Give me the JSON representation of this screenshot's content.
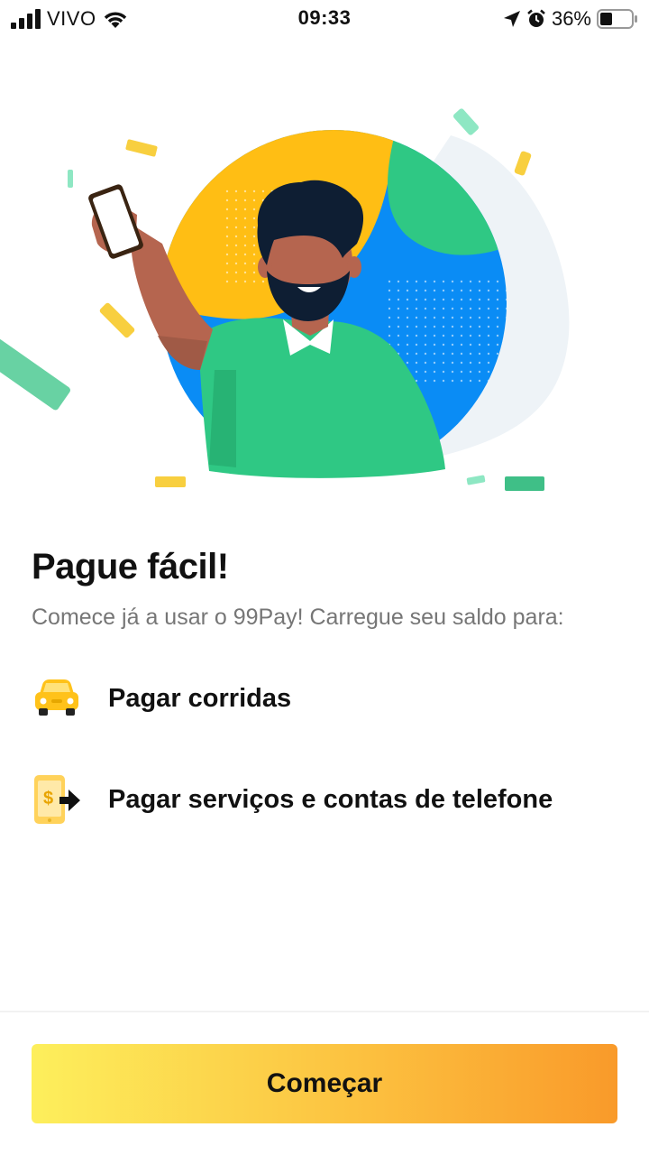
{
  "status_bar": {
    "carrier": "VIVO",
    "time": "09:33",
    "battery_percent": "36%",
    "icons": [
      "signal-icon",
      "wifi-icon",
      "location-arrow-icon",
      "alarm-icon",
      "battery-icon"
    ]
  },
  "hero": {
    "illustration": "man-holding-phone-celebrating-illustration"
  },
  "content": {
    "title": "Pague fácil!",
    "subtitle": "Comece já a usar o 99Pay! Carregue seu saldo para:",
    "features": [
      {
        "icon": "car-icon",
        "label": "Pagar corridas"
      },
      {
        "icon": "phone-payment-icon",
        "label": "Pagar serviços e contas de telefone"
      }
    ]
  },
  "cta": {
    "label": "Começar"
  },
  "colors": {
    "yellow": "#FFBE14",
    "green": "#2FC884",
    "blue": "#0A8CF5",
    "cta_gradient_start": "#FDEF5C",
    "cta_gradient_end": "#F99A2A"
  }
}
